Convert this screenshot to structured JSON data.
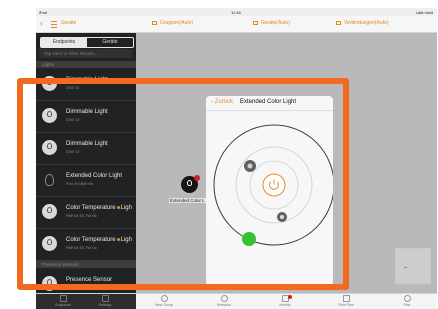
{
  "status_bar": {
    "left": "iPad",
    "time": "11:48",
    "right": "Lädt nicht"
  },
  "nav": {
    "back_glyph": "‹",
    "title": "Geräte",
    "tabs": [
      "Gruppen(Auto)",
      "Geräte(Auto)",
      "Verbindungen(Auto)"
    ]
  },
  "sidebar": {
    "segments": [
      "Endpoints",
      "Geräte"
    ],
    "filter_placeholder": "Tap Here to Filter Results...",
    "section_top": "Lights",
    "items": [
      {
        "name": "Dimmable Light",
        "sub": "DSE 01",
        "icon": "bulb-icon"
      },
      {
        "name": "Dimmable Light",
        "sub": "DSE 02",
        "icon": "bulb-icon"
      },
      {
        "name": "Dimmable Light",
        "sub": "DSE 07",
        "icon": "bulb-icon"
      },
      {
        "name": "Extended Color Light",
        "sub": "Flex RGBW 98",
        "icon": "bulb-outline-icon"
      },
      {
        "name": "Color Temperature",
        "name_suffix": "Ligh",
        "sub": "PAR16 50 TW 86",
        "icon": "bulb-icon"
      },
      {
        "name": "Color Temperature",
        "name_suffix": "Ligh",
        "sub": "PAR16 50 TW 04",
        "icon": "bulb-icon"
      }
    ],
    "section_bottom": "Presence Sensors",
    "partial_item": "Presence Sensor"
  },
  "canvas": {
    "node_label": "Extended Color L"
  },
  "popover": {
    "back_label": "Zurück",
    "title": "Extended Color Light"
  },
  "bottom_bar": {
    "left": [
      "Endpoints",
      "Settings"
    ],
    "right": [
      "New Group",
      "Selection",
      "Identify",
      "Flow Plan",
      "Plan"
    ]
  },
  "colors": {
    "accent": "#e8892a",
    "highlight": "#f26a1d",
    "knob": "#37c12f",
    "badge": "#d21d24"
  }
}
